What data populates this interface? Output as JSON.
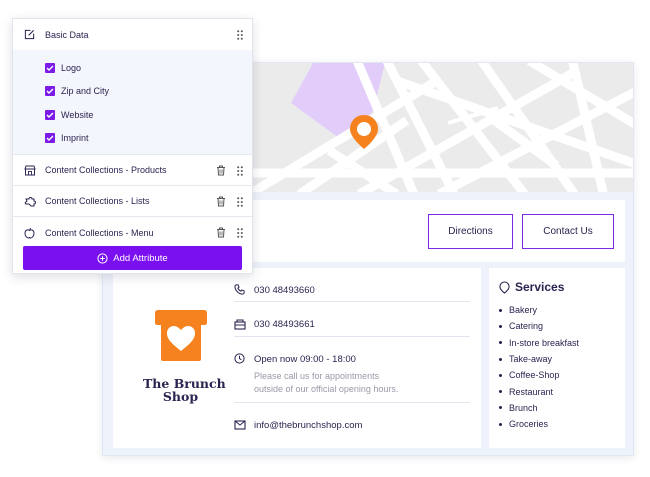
{
  "editor": {
    "basic_data_label": "Basic Data",
    "sub_items": [
      {
        "label": "Logo",
        "checked": true
      },
      {
        "label": "Zip and City",
        "checked": true
      },
      {
        "label": "Website",
        "checked": true
      },
      {
        "label": "Imprint",
        "checked": true
      }
    ],
    "collections": [
      {
        "label": "Content Collections - Products",
        "icon": "shop-icon"
      },
      {
        "label": "Content Collections - Lists",
        "icon": "puzzle-icon"
      },
      {
        "label": "Content Collections - Menu",
        "icon": "apple-icon"
      }
    ],
    "add_button_label": "Add Attribute"
  },
  "card": {
    "directions_label": "Directions",
    "contact_label": "Contact Us",
    "logo_line1": "The Brunch",
    "logo_line2": "Shop",
    "phone": "030 48493660",
    "fax": "030 48493661",
    "hours": "Open now  09:00 - 18:00",
    "hours_note_line1": "Please call us for appointments",
    "hours_note_line2": "outside of our official opening hours.",
    "email": "info@thebrunchshop.com",
    "services_title": "Services",
    "services": [
      "Bakery",
      "Catering",
      "In-store breakfast",
      "Take-away",
      "Coffee-Shop",
      "Restaurant",
      "Brunch",
      "Groceries"
    ]
  },
  "colors": {
    "accent": "#7a0ff0",
    "pin": "#f5821f",
    "map_highlight": "#e2cdfa",
    "text": "#2b2350"
  }
}
